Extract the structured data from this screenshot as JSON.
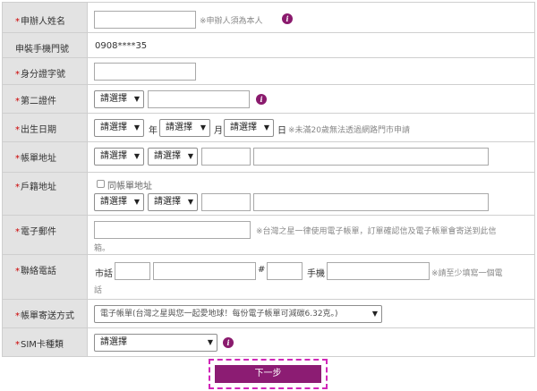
{
  "applicant_name": {
    "label": "申辦人姓名",
    "note": "※申辦人須為本人"
  },
  "phone": {
    "label": "申裝手機門號",
    "value": "0908****35"
  },
  "id_number": {
    "label": "身分證字號"
  },
  "second_id": {
    "label": "第二證件",
    "select": "請選擇"
  },
  "birthday": {
    "label": "出生日期",
    "year_select": "請選擇",
    "year_unit": "年",
    "month_select": "請選擇",
    "month_unit": "月",
    "day_select": "請選擇",
    "day_unit": "日",
    "note": "※未滿20歲無法透過網路門市申請"
  },
  "billing_address": {
    "label": "帳單地址",
    "city_select": "請選擇",
    "district_select": "請選擇"
  },
  "household_address": {
    "label": "戶籍地址",
    "same_as_billing": "同帳單地址",
    "city_select": "請選擇",
    "district_select": "請選擇"
  },
  "email": {
    "label": "電子郵件",
    "note_line1": "※台灣之星一律使用電子帳單，訂單確認信及電子帳單會寄送到此信",
    "note_line2": "箱。"
  },
  "contact_phone": {
    "label": "聯絡電話",
    "landline_label": "市話",
    "hash": "#",
    "mobile_label": "手機",
    "note_line1": "※請至少填寫一個電",
    "note_line2": "話"
  },
  "bill_delivery": {
    "label": "帳單寄送方式",
    "select": "電子帳單(台灣之星與您一起愛地球！每份電子帳單可減碳6.32克。)"
  },
  "sim_type": {
    "label": "SIM卡種類",
    "select": "請選擇"
  },
  "required_mark": "*",
  "info_glyph": "i",
  "arrow_glyph": "▼",
  "next_button": "下一步",
  "colors": {
    "label_bg": "#e3e3e3",
    "required": "#cc0000",
    "accent": "#8c1c73",
    "focus_ring": "#d126b8"
  }
}
